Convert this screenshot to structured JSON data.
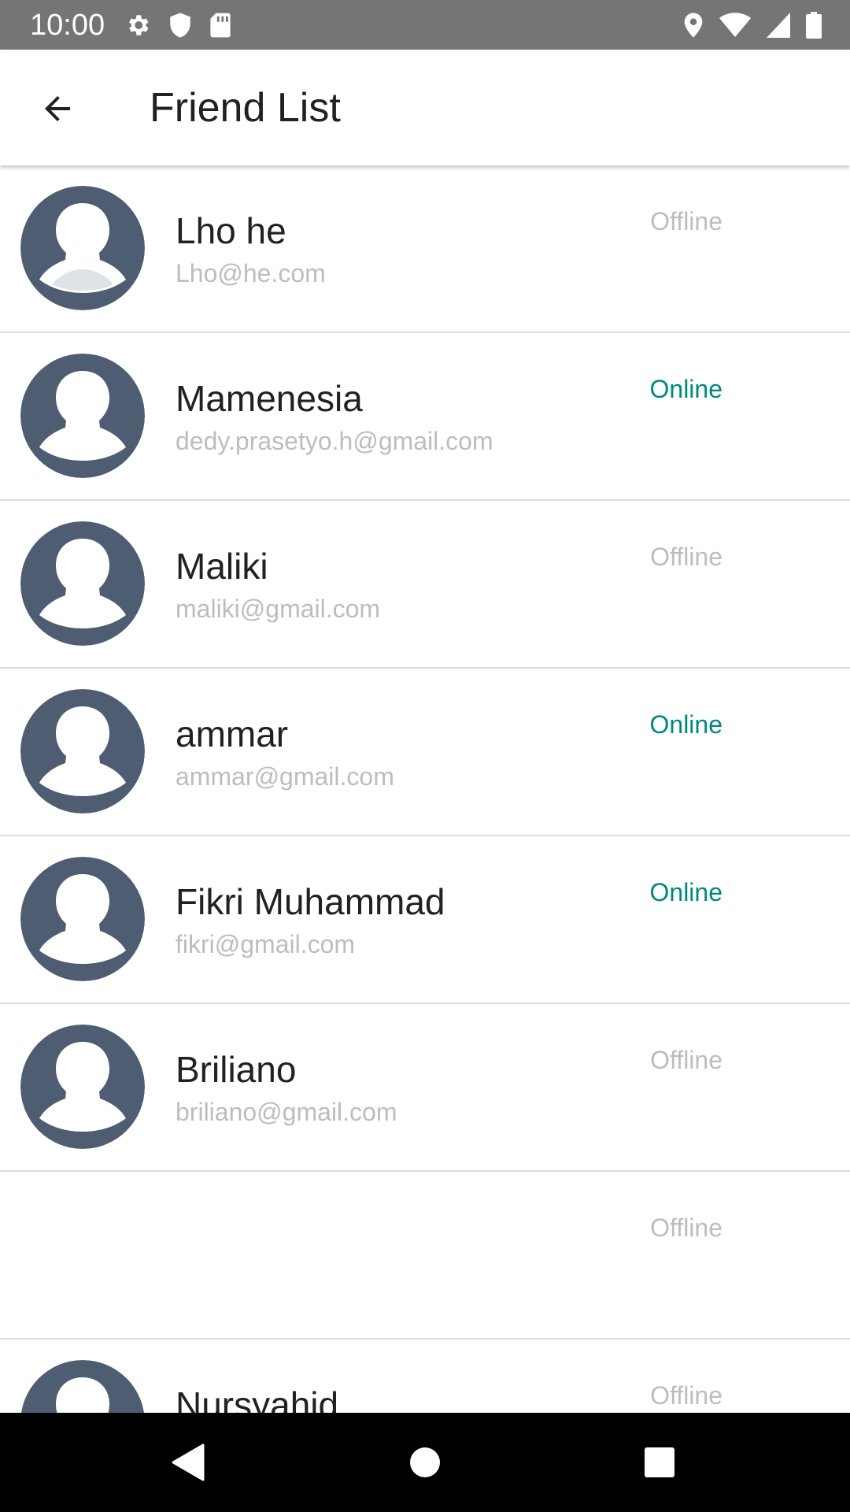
{
  "status_bar": {
    "time": "10:00",
    "left_icons": [
      "gear-icon",
      "shield-icon",
      "sd-card-icon"
    ],
    "right_icons": [
      "location-icon",
      "wifi-icon",
      "signal-icon",
      "battery-icon"
    ]
  },
  "app_bar": {
    "back_icon": "arrow-back-icon",
    "title": "Friend List"
  },
  "colors": {
    "status_bar": "#757575",
    "avatar_bg": "#4f5d73",
    "online": "#00897b",
    "offline": "#bdbdbd",
    "name": "#212121"
  },
  "friends": [
    {
      "name": "Lho he",
      "email": "Lho@he.com",
      "status": "Offline",
      "has_avatar": true
    },
    {
      "name": "Mamenesia",
      "email": "dedy.prasetyo.h@gmail.com",
      "status": "Online",
      "has_avatar": true
    },
    {
      "name": "Maliki",
      "email": "maliki@gmail.com",
      "status": "Offline",
      "has_avatar": true
    },
    {
      "name": "ammar",
      "email": "ammar@gmail.com",
      "status": "Online",
      "has_avatar": true
    },
    {
      "name": "Fikri Muhammad",
      "email": "fikri@gmail.com",
      "status": "Online",
      "has_avatar": true
    },
    {
      "name": "Briliano",
      "email": "briliano@gmail.com",
      "status": "Offline",
      "has_avatar": true
    },
    {
      "name": "",
      "email": "",
      "status": "Offline",
      "has_avatar": false
    },
    {
      "name": "Nursyahid",
      "email": "",
      "status": "Offline",
      "has_avatar": true
    }
  ],
  "nav_bar": {
    "buttons": [
      "nav-back-icon",
      "nav-home-icon",
      "nav-recents-icon"
    ]
  }
}
